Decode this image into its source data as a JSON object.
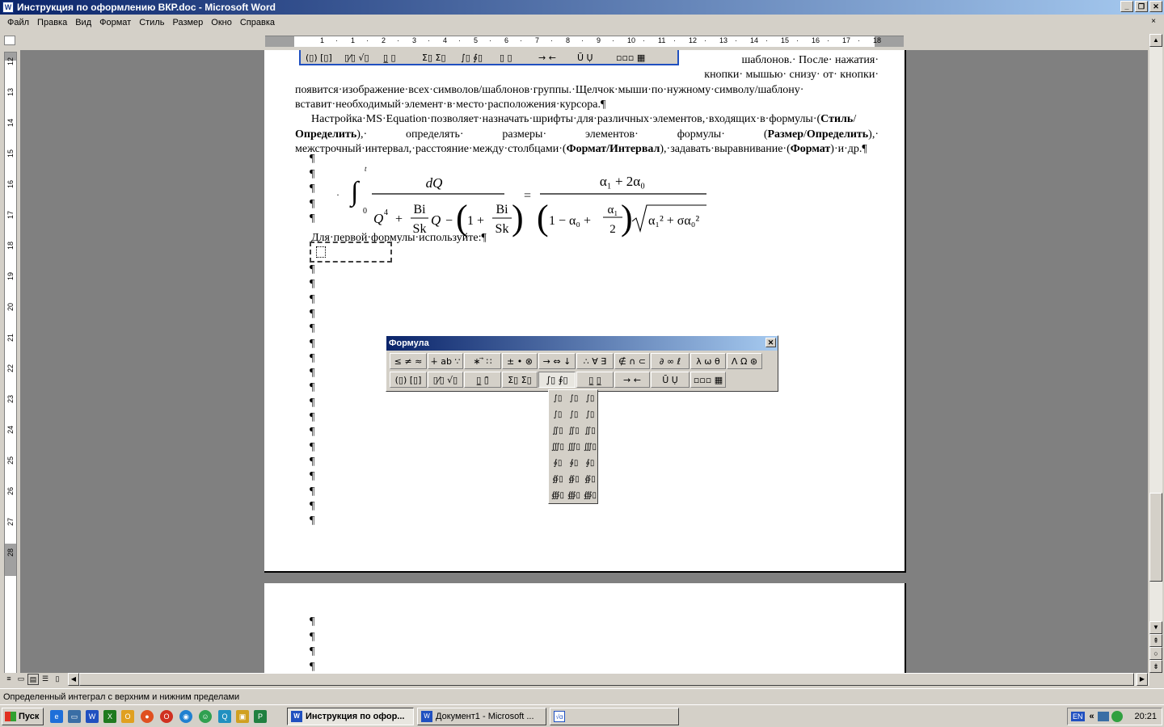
{
  "window": {
    "title": "Инструкция по оформлению ВКР.doc - Microsoft Word",
    "buttons": [
      "_",
      "❐",
      "✕"
    ]
  },
  "menu": [
    {
      "label": "Файл"
    },
    {
      "label": "Правка"
    },
    {
      "label": "Вид"
    },
    {
      "label": "Формат"
    },
    {
      "label": "Стиль"
    },
    {
      "label": "Размер"
    },
    {
      "label": "Окно"
    },
    {
      "label": "Справка"
    }
  ],
  "menu_close": "×",
  "ruler_h": [
    "1",
    "·",
    "1",
    "·",
    "2",
    "·",
    "3",
    "·",
    "4",
    "·",
    "5",
    "·",
    "6",
    "·",
    "7",
    "·",
    "8",
    "·",
    "9",
    "·",
    "10",
    "·",
    "11",
    "·",
    "12",
    "·",
    "13",
    "·",
    "14",
    "·",
    "15",
    "·",
    "16",
    "·",
    "17",
    "·",
    "18"
  ],
  "ruler_v": [
    "12",
    "13",
    "14",
    "15",
    "16",
    "17",
    "18",
    "19",
    "20",
    "21",
    "22",
    "23",
    "24",
    "25",
    "26",
    "27",
    "28"
  ],
  "document": {
    "line1": "шаблонов.· После· нажатия·",
    "line2": "кнопки· мышью· снизу· от· кнопки·",
    "line3": "появится·изображение·всех·символов/шаблонов·группы.·Щелчок·мыши·по·нужному·символу/шаблону·",
    "line4": "вставит·необходимый·элемент·в·место·расположения·курсора.¶",
    "para2_a": "Настройка·MS·Equation·позволяет·назначать·шрифты·для·различных·элементов,·входящих·в·формулы·(",
    "para2_b1": "Стиль",
    "para2_b2": "/",
    "para2_b3": "Определить",
    "para2_c": "),· определять· размеры· элементов· формулы· (",
    "para2_d1": "Размер",
    "para2_d2": "/",
    "para2_d3": "Определить",
    "para2_e": "),· межстрочный·",
    "para2_f": "интервал,·расстояние·между·столбцами·(",
    "para2_g": "Формат/Интервал",
    "para2_h": "),·задавать·выравнивание·(",
    "para2_i": "Формат",
    "para2_j": ")·и·др.¶",
    "formula_label": "Для·первой·формулы·используйте:¶",
    "pilcrow": "¶"
  },
  "formula": {
    "int_upper": "t",
    "int_lower": "0",
    "num_left": "dQ",
    "q4": "Q",
    "q4_exp": "4",
    "plus": "+",
    "bi": "Bi",
    "sk": "Sk",
    "q": "Q",
    "minus": "−",
    "one_plus": "1 +",
    "equals": "=",
    "num_right": "α₁ + 2α₀",
    "den_right_a": "1 − α₀ +",
    "alpha1": "α₁",
    "two": "2",
    "sqrt_content": "α₁² + σα₀²"
  },
  "formula_toolbar": {
    "title": "Формула",
    "close": "✕",
    "row1": [
      "≤ ≠ ≈",
      "∔ ab ∵",
      "∗ ⃗ ∷",
      "± • ⊗",
      "→ ⇔ ↓",
      "∴ ∀ ∃",
      "∉ ∩ ⊂",
      "∂ ∞ ℓ",
      "λ ω θ",
      "Λ Ω ⊛"
    ],
    "row2": [
      "(▯) [▯]",
      "▯⁄▯ √▯",
      "▯̲ ▯̄",
      "Σ▯ Σ▯",
      "∫▯ ∮▯",
      "▯̲ ▯̲",
      "→ ←",
      "Ū Ụ",
      "▫▫▫ ▦"
    ]
  },
  "embedded_toolbar": {
    "row": [
      "(▯) [▯]",
      "▯⁄▯ √▯",
      "▯̲ ▯",
      "Σ▯ Σ▯",
      "∫▯ ∮▯",
      "▯ ▯",
      "→ ←",
      "Ū Ụ",
      "▫▫▫ ▦"
    ]
  },
  "palette": {
    "cells": [
      "∫▯",
      "∫▯",
      "∫▯",
      "∫▯",
      "∫▯",
      "∫▯",
      "∬▯",
      "∬▯",
      "∬▯",
      "∭▯",
      "∭▯",
      "∭▯",
      "∮▯",
      "∮▯",
      "∮▯",
      "∯▯",
      "∯▯",
      "∯▯",
      "∰▯",
      "∰▯",
      "∰▯"
    ]
  },
  "statusbar": {
    "text": "Определенный интеграл с верхним и нижним пределами"
  },
  "taskbar": {
    "start": "Пуск",
    "tasks": [
      {
        "label": "Инструкция по офор..."
      },
      {
        "label": "Документ1 - Microsoft ..."
      },
      {
        "label": ""
      }
    ],
    "lang": "EN",
    "chevron": "«",
    "clock": "20:21"
  },
  "colors": {
    "title_gradient_start": "#0a246a",
    "title_gradient_end": "#a6caf0",
    "face": "#d4d0c8",
    "workspace": "#808080"
  }
}
